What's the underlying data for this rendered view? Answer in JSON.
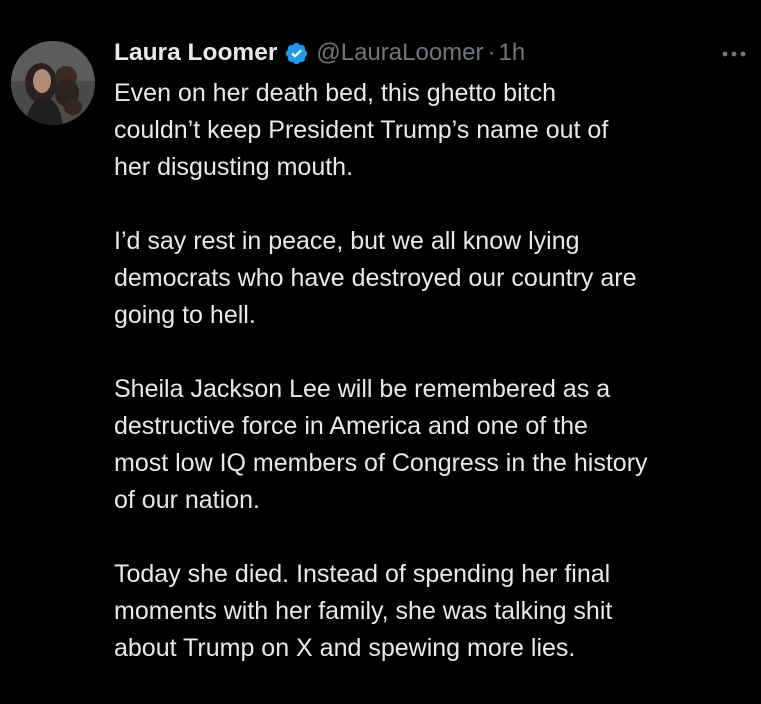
{
  "author": {
    "display_name": "Laura Loomer",
    "handle": "@LauraLoomer",
    "separator": "·",
    "time": "1h",
    "verified_icon": "verified-badge-icon",
    "avatar_icon": "profile-photo"
  },
  "menu": {
    "icon": "more-options-icon"
  },
  "tweet": {
    "paragraphs": [
      "Even on her death bed, this ghetto bitch\ncouldn’t keep President Trump’s name out of\nher disgusting mouth.",
      "I’d say rest in peace, but we all know lying\ndemocrats who have destroyed our country are\ngoing to hell.",
      "Sheila Jackson Lee will be remembered as a\ndestructive force in America and one of the\nmost low IQ members of Congress in the history\nof our nation.",
      "Today she died. Instead of spending her final\nmoments with her family, she was talking shit\nabout Trump on X and spewing more lies."
    ]
  },
  "colors": {
    "background": "#000000",
    "text": "#e7e9ea",
    "secondary": "#71767b",
    "verified": "#1d9bf0"
  }
}
